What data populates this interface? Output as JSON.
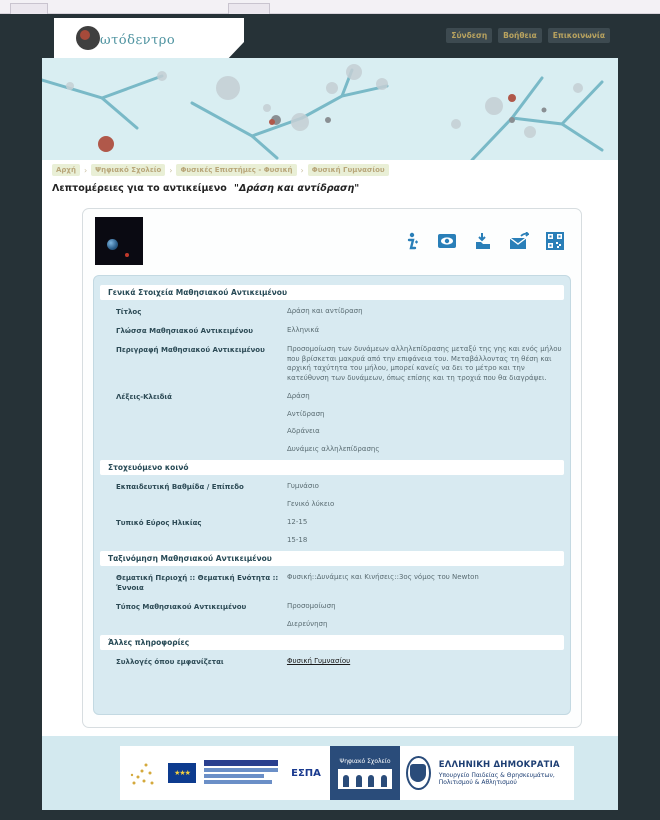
{
  "header": {
    "logo_text": "ωτόδεντρο",
    "top_links": [
      "Σύνδεση",
      "Βοήθεια",
      "Επικοινωνία"
    ]
  },
  "breadcrumb": [
    "Αρχή",
    "Ψηφιακό Σχολείο",
    "Φυσικές Επιστήμες - Φυσική",
    "Φυσική Γυμνασίου"
  ],
  "page_title": {
    "prefix": "Λεπτομέρειες για το αντικείμενο",
    "object_title": "\"Δράση και αντίδραση\""
  },
  "actions": [
    "info-icon",
    "preview-icon",
    "download-icon",
    "share-icon",
    "qr-code-icon"
  ],
  "colors": {
    "frame": "#263237",
    "header_band": "#d9eef2",
    "metadata_panel": "#d8eaf1",
    "accent_icons": "#2a7fb8"
  },
  "metadata": {
    "general": {
      "heading": "Γενικά Στοιχεία Μαθησιακού Αντικειμένου",
      "title_label": "Τίτλος",
      "title_value": "Δράση και αντίδραση",
      "language_label": "Γλώσσα Μαθησιακού Αντικειμένου",
      "language_value": "Ελληνικά",
      "description_label": "Περιγραφή Μαθησιακού Αντικειμένου",
      "description_value": "Προσομοίωση των δυνάμεων αλληλεπίδρασης μεταξύ της γης και ενός μήλου που βρίσκεται μακρυά από την επιφάνεια του. Μεταβάλλοντας τη θέση και αρχική ταχύτητα του μήλου, μπορεί κανείς να δει το μέτρο και την κατεύθυνση των δυνάμεων, όπως επίσης και τη τροχιά που θα διαγράψει.",
      "keywords_label": "Λέξεις-Κλειδιά",
      "keywords": [
        "Δράση",
        "Αντίδραση",
        "Αδράνεια",
        "Δυνάμεις αλληλεπίδρασης"
      ]
    },
    "audience": {
      "heading": "Στοχευόμενο κοινό",
      "level_label": "Εκπαιδευτική Βαθμίδα / Επίπεδο",
      "levels": [
        "Γυμνάσιο",
        "Γενικό λύκειο"
      ],
      "age_label": "Τυπικό Εύρος Ηλικίας",
      "ages": [
        "12-15",
        "15-18"
      ]
    },
    "classification": {
      "heading": "Ταξινόμηση Μαθησιακού Αντικειμένου",
      "area_label": "Θεματική Περιοχή :: Θεματική Ενότητα :: Έννοια",
      "area_value": "Φυσική::Δυνάμεις και Κινήσεις::3ος νόμος του Newton",
      "type_label": "Τύπος  Μαθησιακού Αντικειμένου",
      "types": [
        "Προσομοίωση",
        "Διερεύνηση"
      ]
    },
    "other": {
      "heading": "Άλλες πληροφορίες",
      "collections_label": "Συλλογές όπου εμφανίζεται",
      "collection_link": "Φυσική Γυμνασίου"
    }
  },
  "footer": {
    "espa_label": "ΕΣΠΑ",
    "digital_school_label": "Ψηφιακό Σχολείο",
    "greek_republic": "ΕΛΛΗΝΙΚΗ ΔΗΜΟΚΡΑΤΙΑ",
    "ministry": "Υπουργείο Παιδείας & Θρησκευμάτων, Πολιτισμού & Αθλητισμού"
  }
}
